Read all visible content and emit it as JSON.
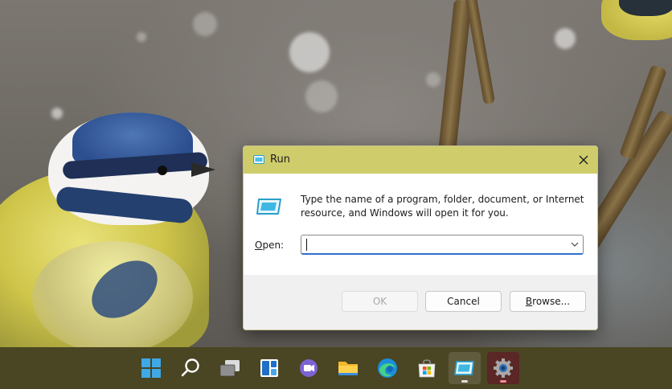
{
  "run_dialog": {
    "title": "Run",
    "description": "Type the name of a program, folder, document, or Internet resource, and Windows will open it for you.",
    "open_label_mnemonic": "O",
    "open_label_rest": "pen:",
    "open_value": "",
    "buttons": {
      "ok": "OK",
      "cancel": "Cancel",
      "browse_mnemonic": "B",
      "browse_rest": "rowse..."
    }
  },
  "colors": {
    "titlebar": "#cfcc6b",
    "taskbar": "#4a4522",
    "input_focus": "#2f6fcf"
  },
  "taskbar": {
    "items": [
      {
        "name": "start-icon"
      },
      {
        "name": "search-icon"
      },
      {
        "name": "task-view-icon"
      },
      {
        "name": "widgets-icon"
      },
      {
        "name": "chat-icon"
      },
      {
        "name": "file-explorer-icon"
      },
      {
        "name": "edge-icon"
      },
      {
        "name": "store-icon"
      },
      {
        "name": "run-app-icon",
        "state": "active"
      },
      {
        "name": "settings-icon",
        "state": "active"
      }
    ]
  }
}
